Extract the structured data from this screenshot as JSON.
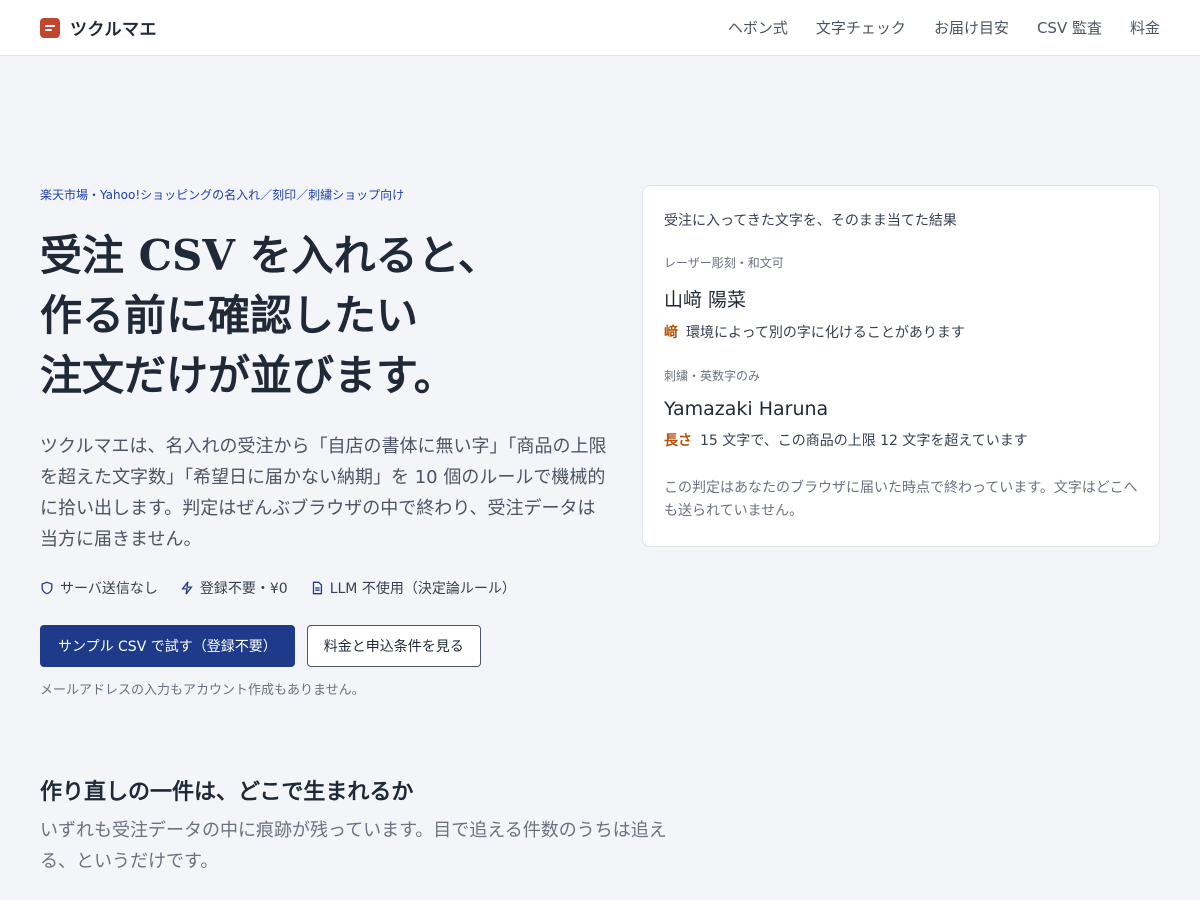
{
  "header": {
    "brand": "ツクルマエ",
    "nav": [
      "ヘボン式",
      "文字チェック",
      "お届け目安",
      "CSV 監査",
      "料金"
    ]
  },
  "hero": {
    "kicker": "楽天市場・Yahoo!ショッピングの名入れ／刻印／刺繍ショップ向け",
    "headline": [
      "受注 CSV を入れると、",
      "作る前に確認したい",
      "注文だけが並びます。"
    ],
    "lead": "ツクルマエは、名入れの受注から「自店の書体に無い字」「商品の上限を超えた文字数」「希望日に届かない納期」を 10 個のルールで機械的に拾い出します。判定はぜんぶブラウザの中で終わり、受注データは当方に届きません。",
    "features": [
      {
        "icon": "shield-icon",
        "label": "サーバ送信なし"
      },
      {
        "icon": "lightning-icon",
        "label": "登録不要・¥0"
      },
      {
        "icon": "document-icon",
        "label": "LLM 不使用（決定論ルール）"
      }
    ],
    "primary_button": "サンプル CSV で試す（登録不要）",
    "secondary_button": "料金と申込条件を見る",
    "note": "メールアドレスの入力もアカウント作成もありません。"
  },
  "card": {
    "title": "受注に入ってきた文字を、そのまま当てた結果",
    "blocks": [
      {
        "meta": "レーザー彫刻・和文可",
        "name": "山﨑 陽菜",
        "tag": "﨑",
        "warning": "環境によって別の字に化けることがあります"
      },
      {
        "meta": "刺繍・英数字のみ",
        "name": "Yamazaki Haruna",
        "tag": "長さ",
        "warning": "15 文字で、この商品の上限 12 文字を超えています"
      }
    ],
    "footer": "この判定はあなたのブラウザに届いた時点で終わっています。文字はどこへも送られていません。"
  },
  "section": {
    "title": "作り直しの一件は、どこで生まれるか",
    "desc": "いずれも受注データの中に痕跡が残っています。目で追える件数のうちは追える、というだけです。"
  },
  "colors": {
    "accent": "#1e3a8a",
    "brand": "#c2452d",
    "warning": "#b45309"
  }
}
